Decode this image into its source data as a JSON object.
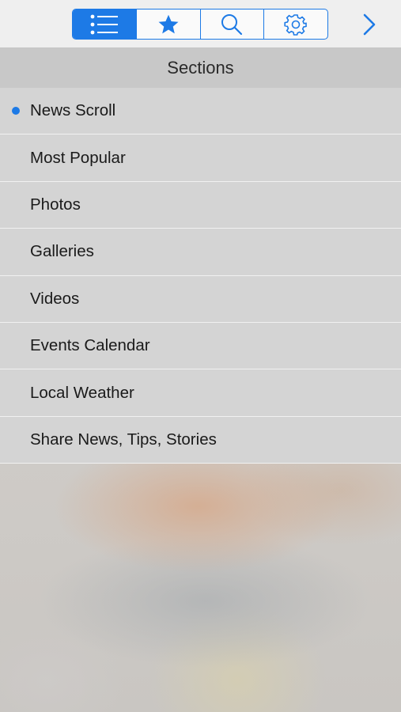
{
  "toolbar": {
    "tabs": [
      {
        "icon": "list-icon",
        "active": true
      },
      {
        "icon": "star-icon",
        "active": false
      },
      {
        "icon": "search-icon",
        "active": false
      },
      {
        "icon": "gear-icon",
        "active": false
      }
    ],
    "next_icon": "chevron-right-icon",
    "accent_color": "#1d7ae6"
  },
  "sections": {
    "title": "Sections",
    "items": [
      {
        "label": "News Scroll",
        "selected": true
      },
      {
        "label": "Most Popular",
        "selected": false
      },
      {
        "label": "Photos",
        "selected": false
      },
      {
        "label": "Galleries",
        "selected": false
      },
      {
        "label": "Videos",
        "selected": false
      },
      {
        "label": "Events Calendar",
        "selected": false
      },
      {
        "label": "Local Weather",
        "selected": false
      },
      {
        "label": "Share News, Tips, Stories",
        "selected": false
      }
    ]
  }
}
